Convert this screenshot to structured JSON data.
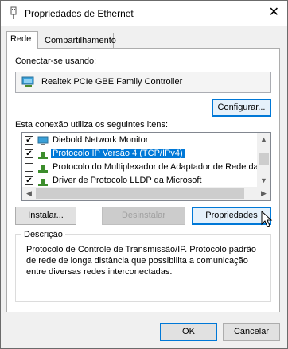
{
  "window": {
    "title": "Propriedades de Ethernet",
    "close_label": "✕"
  },
  "tabs": [
    {
      "label": "Rede"
    },
    {
      "label": "Compartilhamento"
    }
  ],
  "connect_using": {
    "label": "Conectar-se usando:",
    "adapter_name": "Realtek PCIe GBE Family Controller",
    "configure_button": "Configurar..."
  },
  "items_section": {
    "label": "Esta conexão utiliza os seguintes itens:",
    "items": [
      {
        "label": "Diebold Network Monitor",
        "checked": true
      },
      {
        "label": "Protocolo IP Versão 4 (TCP/IPv4)",
        "checked": true,
        "selected": true
      },
      {
        "label": "Protocolo do Multiplexador de Adaptador de Rede da M",
        "checked": false
      },
      {
        "label": "Driver de Protocolo LLDP da Microsoft",
        "checked": true
      }
    ]
  },
  "action_buttons": {
    "install": "Instalar...",
    "uninstall": "Desinstalar",
    "properties": "Propriedades"
  },
  "description": {
    "label": "Descrição",
    "text_line1": "Protocolo de Controle de Transmissão/IP. Protocolo padrão",
    "text_line2": "de rede de longa distância que possibilita a comunicação",
    "text_line3": "entre diversas redes interconectadas."
  },
  "dialog_buttons": {
    "ok": "OK",
    "cancel": "Cancelar"
  }
}
